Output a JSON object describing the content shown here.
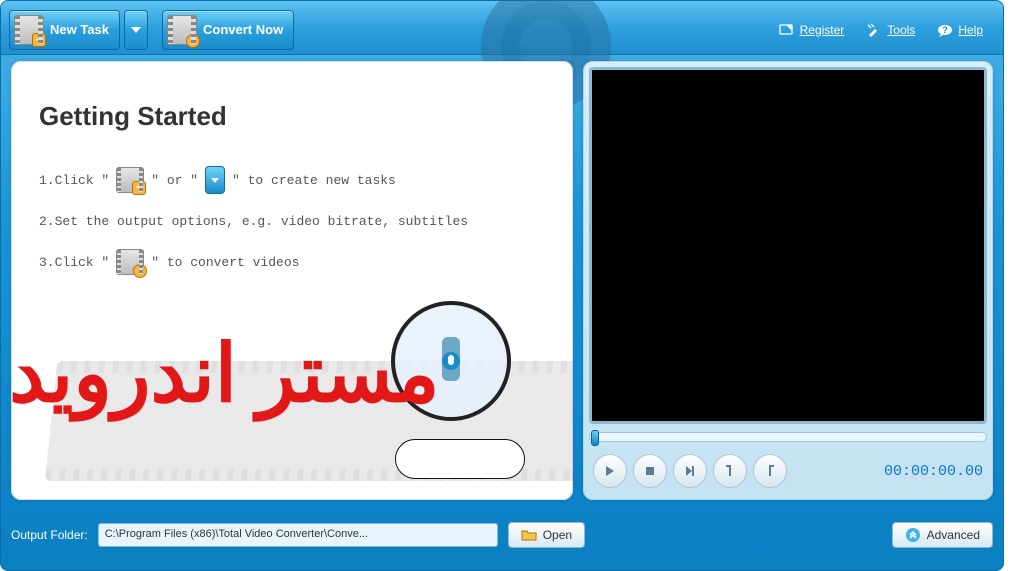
{
  "toolbar": {
    "new_task_label": "New Task",
    "convert_label": "Convert Now",
    "register_label": "Register",
    "tools_label": "Tools",
    "help_label": "Help"
  },
  "getting_started": {
    "title": "Getting Started",
    "step1_a": "1.Click \"",
    "step1_b": "\" or \"",
    "step1_c": "\" to create new tasks",
    "step2": "2.Set the output options, e.g. video bitrate, subtitles",
    "step3_a": "3.Click \"",
    "step3_b": "\" to convert videos"
  },
  "preview": {
    "timecode": "00:00:00.00"
  },
  "footer": {
    "output_folder_label": "Output Folder:",
    "output_folder_path": "C:\\Program Files (x86)\\Total Video Converter\\Conve...",
    "open_label": "Open",
    "advanced_label": "Advanced"
  },
  "watermark_text": "مستر اندرويد"
}
